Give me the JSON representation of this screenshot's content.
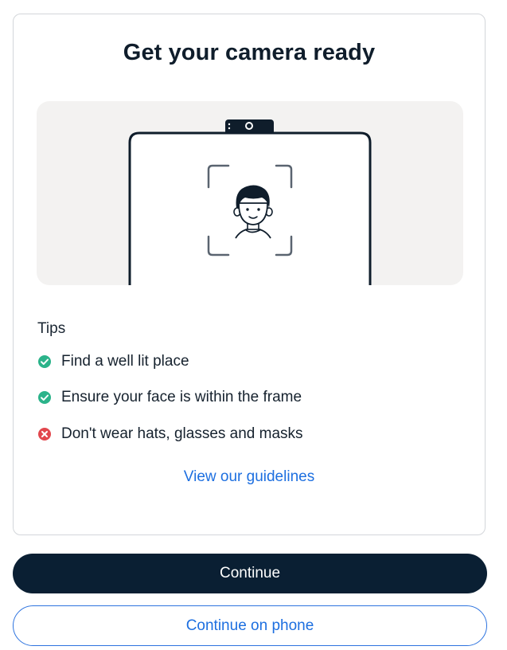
{
  "card": {
    "title": "Get your camera ready",
    "tips_heading": "Tips",
    "tips": [
      {
        "text": "Find a well lit place",
        "status": "ok",
        "icon": "check-circle-icon"
      },
      {
        "text": "Ensure your face is within the frame",
        "status": "ok",
        "icon": "check-circle-icon"
      },
      {
        "text": "Don't wear hats, glasses and masks",
        "status": "bad",
        "icon": "x-circle-icon"
      }
    ],
    "guidelines_link": "View our guidelines"
  },
  "actions": {
    "continue_label": "Continue",
    "continue_phone_label": "Continue on phone"
  },
  "colors": {
    "primary": "#0a1f33",
    "link": "#1d6fe0",
    "ok": "#2bb38a",
    "bad": "#e2474d",
    "illustration_bg": "#f3f2f1"
  }
}
